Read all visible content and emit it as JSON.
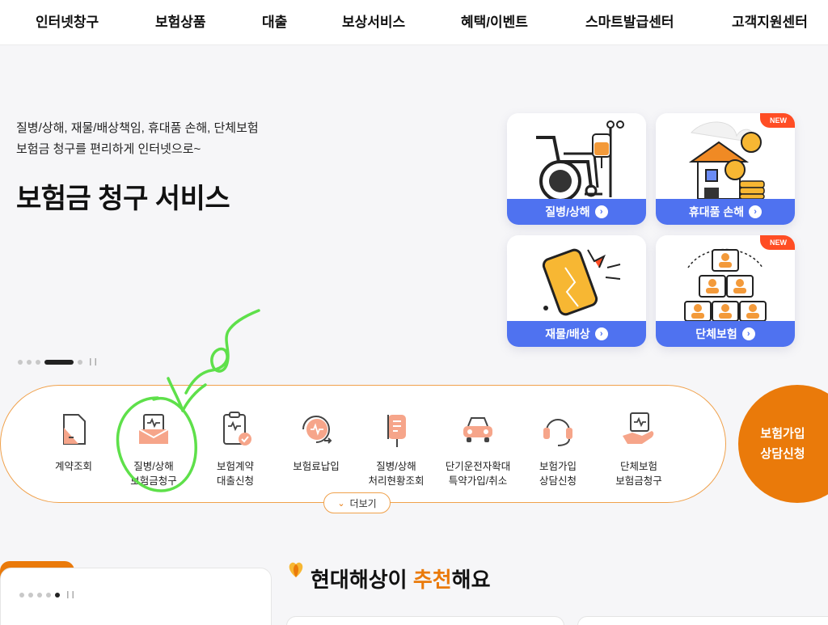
{
  "nav": {
    "items": [
      "인터넷창구",
      "보험상품",
      "대출",
      "보상서비스",
      "혜택/이벤트",
      "스마트발급센터",
      "고객지원센터"
    ]
  },
  "hero": {
    "subtitle_line1": "질병/상해, 재물/배상책임, 휴대품 손해, 단체보험",
    "subtitle_line2": "보험금 청구를 편리하게 인터넷으로~",
    "title": "보험금 청구 서비스"
  },
  "tiles": [
    {
      "label": "질병/상해",
      "badge": "",
      "icon": "wheelchair-iv-icon"
    },
    {
      "label": "휴대품 손해",
      "badge": "NEW",
      "icon": "house-coins-icon"
    },
    {
      "label": "재물/배상",
      "badge": "",
      "icon": "broken-phone-icon"
    },
    {
      "label": "단체보험",
      "badge": "NEW",
      "icon": "group-people-icon"
    }
  ],
  "quick_menu": [
    {
      "label": "계약조회",
      "icon": "document-icon"
    },
    {
      "label": "질병/상해\n보험금청구",
      "icon": "claim-envelope-icon"
    },
    {
      "label": "보험계약\n대출신청",
      "icon": "clipboard-check-icon"
    },
    {
      "label": "보험료납입",
      "icon": "payment-icon"
    },
    {
      "label": "질병/상해\n처리현황조회",
      "icon": "iv-bag-icon"
    },
    {
      "label": "단기운전자확대\n특약가입/취소",
      "icon": "car-icon"
    },
    {
      "label": "보험가입\n상담신청",
      "icon": "headset-icon"
    },
    {
      "label": "단체보험\n보험금청구",
      "icon": "hand-document-icon"
    }
  ],
  "more_button": "더보기",
  "consult": {
    "label": "보험가입\n상담신청"
  },
  "recommend": {
    "prefix": "현대해상이 ",
    "highlight": "추천",
    "suffix": "해요"
  },
  "colors": {
    "accent": "#ea7a0a",
    "tile_blue": "#4f72f0",
    "annotation_green": "#5ee04a"
  }
}
